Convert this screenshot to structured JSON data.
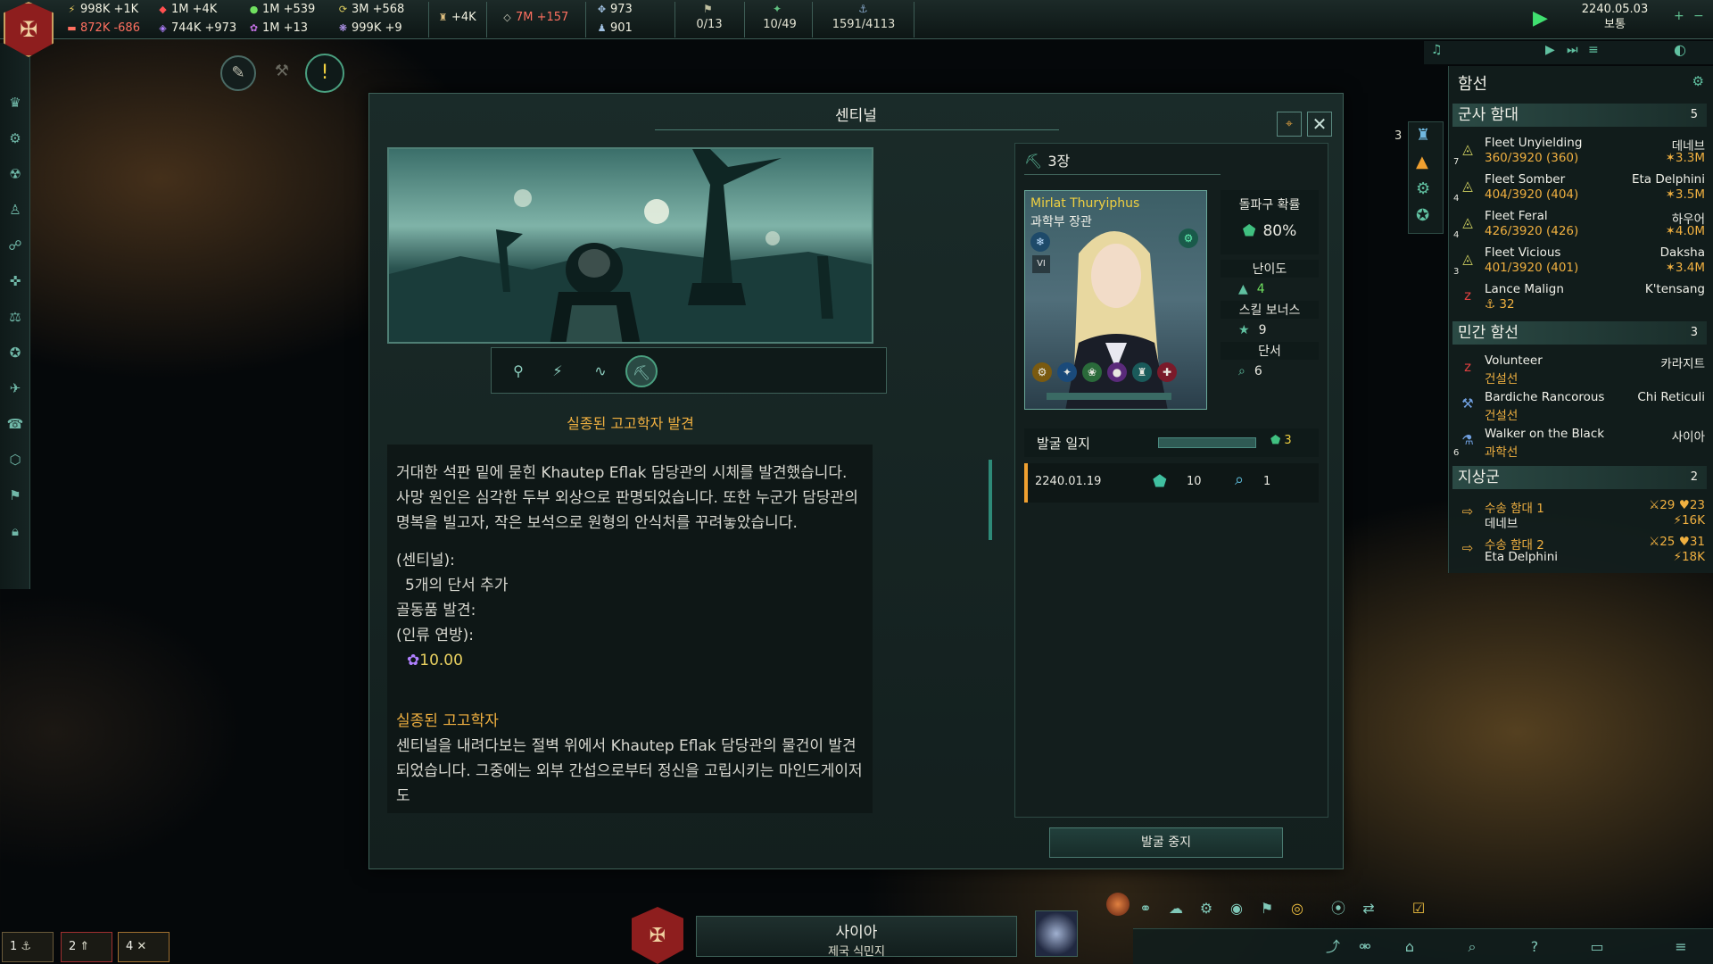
{
  "resources": [
    {
      "name": "energy",
      "icon": "energy-icon",
      "glyph": "⚡",
      "value": "998K +1K",
      "neg": false
    },
    {
      "name": "minerals",
      "icon": "minerals-icon",
      "glyph": "◆",
      "value": "1M +4K",
      "neg": false
    },
    {
      "name": "food",
      "icon": "food-icon",
      "glyph": "●",
      "value": "1M +539",
      "neg": false
    },
    {
      "name": "consumer-goods",
      "icon": "consumer-goods-icon",
      "glyph": "⟳",
      "value": "3M +568",
      "neg": false
    },
    {
      "name": "alloys",
      "icon": "alloys-icon",
      "glyph": "▬",
      "value": "872K -686",
      "neg": true
    },
    {
      "name": "volatile-motes",
      "icon": "motes-icon",
      "glyph": "◈",
      "value": "744K +973",
      "neg": false
    },
    {
      "name": "exotic-gases",
      "icon": "gas-icon",
      "glyph": "✿",
      "value": "1M +13",
      "neg": false
    },
    {
      "name": "rare-crystals",
      "icon": "crystal-icon",
      "glyph": "❋",
      "value": "999K +9",
      "neg": false
    }
  ],
  "influence": "+4K",
  "unity": "7M +157",
  "amenities": "973",
  "pops": "901",
  "counters": {
    "envoys": "0/13",
    "starbases": "10/49",
    "naval": "1591/4113"
  },
  "date": "2240.05.03",
  "speed": "보통",
  "dialog": {
    "title": "센티널",
    "chapter_title": "실종된 고고학자 발견",
    "paragraph1": "거대한 석판 밑에 묻힌 Khautep Eflak 담당관의 시체를 발견했습니다. 사망 원인은 심각한 두부 외상으로 판명되었습니다. 또한 누군가 담당관의 명복을 빌고자, 작은 보석으로 원형의 안식처를 꾸려놓았습니다.",
    "sentinel_label": "(센티널):",
    "clue_line": "5개의 단서 추가",
    "artifact_line": "골동품 발견:",
    "faction_line": "(인류 연방):",
    "artifact_value": "10.00",
    "section2_title": "실종된 고고학자",
    "paragraph2": "센티널을 내려다보는 절벽 위에서 Khautep Eflak 담당관의 물건이 발견되었습니다. 그중에는 외부 간섭으로부터 정신을 고립시키는 마인드게이저도",
    "chapter": "3장",
    "leader_name": "Mirlat Thuryiphus",
    "leader_role": "과학부 장관",
    "leader_level": "VI",
    "breakthrough_label": "돌파구 확률",
    "breakthrough_value": "80%",
    "difficulty_label": "난이도",
    "difficulty_value": "4",
    "skill_label": "스킬 보너스",
    "skill_value": "9",
    "clues_label": "단서",
    "clues_value": "6",
    "log_label": "발굴 일지",
    "log_count": "3",
    "log_date": "2240.01.19",
    "log_roll": "10",
    "log_clue": "1",
    "stop_button": "발굴 중지"
  },
  "outliner": {
    "title": "함선",
    "sections": [
      {
        "label": "군사 함대",
        "count": "5"
      },
      {
        "label": "민간 함선",
        "count": "3"
      },
      {
        "label": "지상군",
        "count": "2"
      }
    ],
    "fleets": [
      {
        "name": "Fleet Unyielding",
        "loc": "데네브",
        "str": "360/3920 (360)",
        "power": "3.3M",
        "num": "7"
      },
      {
        "name": "Fleet Somber",
        "loc": "Eta Delphini",
        "str": "404/3920 (404)",
        "power": "3.5M",
        "num": "4"
      },
      {
        "name": "Fleet Feral",
        "loc": "하우어",
        "str": "426/3920 (426)",
        "power": "4.0M",
        "num": "4"
      },
      {
        "name": "Fleet Vicious",
        "loc": "Daksha",
        "str": "401/3920 (401)",
        "power": "3.4M",
        "num": "3"
      },
      {
        "name": "Lance Malign",
        "loc": "K'tensang",
        "str": "32",
        "power": "",
        "num": ""
      }
    ],
    "civilian": [
      {
        "name": "Volunteer",
        "loc": "카라지트",
        "type": "건설선"
      },
      {
        "name": "Bardiche Rancorous",
        "loc": "Chi Reticuli",
        "type": "건설선"
      },
      {
        "name": "Walker on the Black",
        "loc": "사이아",
        "type": "과학선",
        "num": "6"
      }
    ],
    "armies": [
      {
        "name": "수송 함대 1",
        "loc": "데네브",
        "a": "29",
        "b": "23",
        "c": "16K"
      },
      {
        "name": "수송 함대 2",
        "loc": "Eta Delphini",
        "a": "25",
        "b": "31",
        "c": "18K"
      }
    ],
    "side_count": "3"
  },
  "planet": {
    "name": "사이아",
    "type": "제국 식민지"
  },
  "bottom_left": [
    {
      "n": "1"
    },
    {
      "n": "2"
    },
    {
      "n": "4"
    }
  ]
}
